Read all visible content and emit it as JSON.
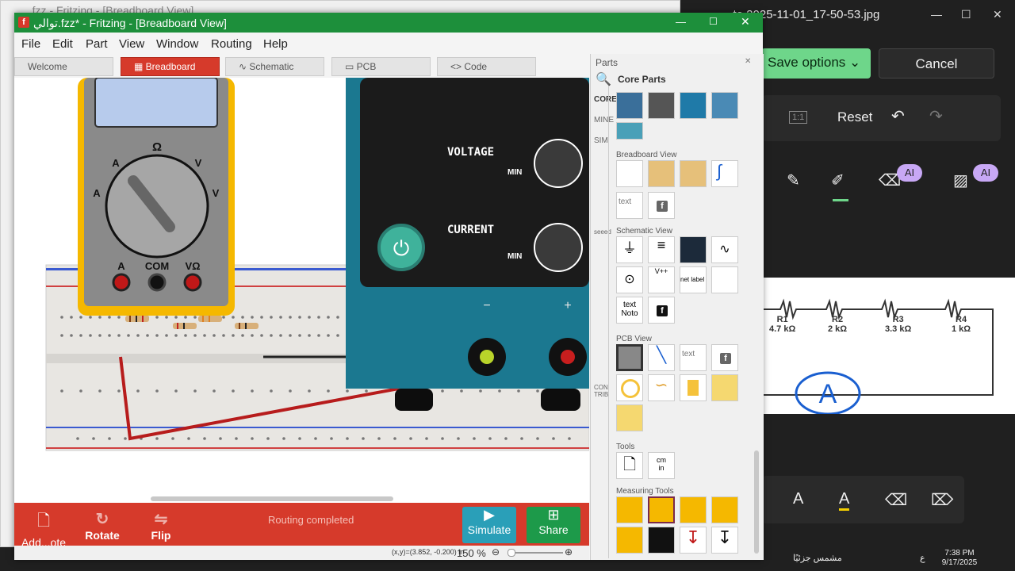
{
  "bg_fritzing": {
    "title": "...fzz - Fritzing - [Breadboard View]"
  },
  "photos": {
    "title": "...te 2025-11-01_17-50-53.jpg",
    "save_options": "Save options",
    "cancel": "Cancel",
    "reset": "Reset",
    "ai_badge_1": "AI",
    "ai_badge_2": "AI",
    "resistors": [
      {
        "name": "R1",
        "value": "4.7 kΩ"
      },
      {
        "name": "R2",
        "value": "2 kΩ"
      },
      {
        "name": "R3",
        "value": "3.3 kΩ"
      },
      {
        "name": "R4",
        "value": "1 kΩ"
      }
    ],
    "handwritten": "A"
  },
  "window": {
    "title": "توالي.fzz* - Fritzing - [Breadboard View]",
    "menus": [
      "File",
      "Edit",
      "Part",
      "View",
      "Window",
      "Routing",
      "Help"
    ],
    "tabs": [
      "Welcome",
      "Breadboard",
      "Schematic",
      "PCB",
      "Code"
    ],
    "active_tab": "Breadboard"
  },
  "canvas": {
    "multimeter": {
      "labels": [
        "Ω",
        "A",
        "V",
        "A",
        "V",
        "A",
        "COM",
        "VΩ"
      ]
    },
    "power_supply": {
      "voltage": "VOLTAGE",
      "current": "CURRENT",
      "min1": "MIN",
      "min2": "MIN",
      "minus": "−",
      "plus": "+"
    }
  },
  "parts": {
    "header": "Parts",
    "bin_title": "Core Parts",
    "categories": [
      "CORE",
      "MINE",
      "SIM",
      "seeed",
      "CON TRIB"
    ],
    "sections": [
      "Breadboard View",
      "Schematic View",
      "PCB View",
      "Tools",
      "Measuring Tools"
    ],
    "text_items": [
      "text",
      "text",
      "net label",
      "text",
      "Noto",
      "cm",
      "in"
    ]
  },
  "bottombar": {
    "add_note": "Add...ote",
    "rotate": "Rotate",
    "flip": "Flip",
    "status": "Routing completed",
    "simulate": "Simulate",
    "share": "Share",
    "coords": "(x,y)=(3.852, -0.200) in",
    "zoom": "150 %"
  },
  "taskbar": {
    "time": "7:38 PM",
    "date": "9/17/2025",
    "weather": "مشمس جزئيًا",
    "lang": "ع"
  },
  "colors": {
    "fritzing_green": "#1d8f3b",
    "fritzing_red": "#d63a2b",
    "teal_ps": "#1b7890"
  }
}
